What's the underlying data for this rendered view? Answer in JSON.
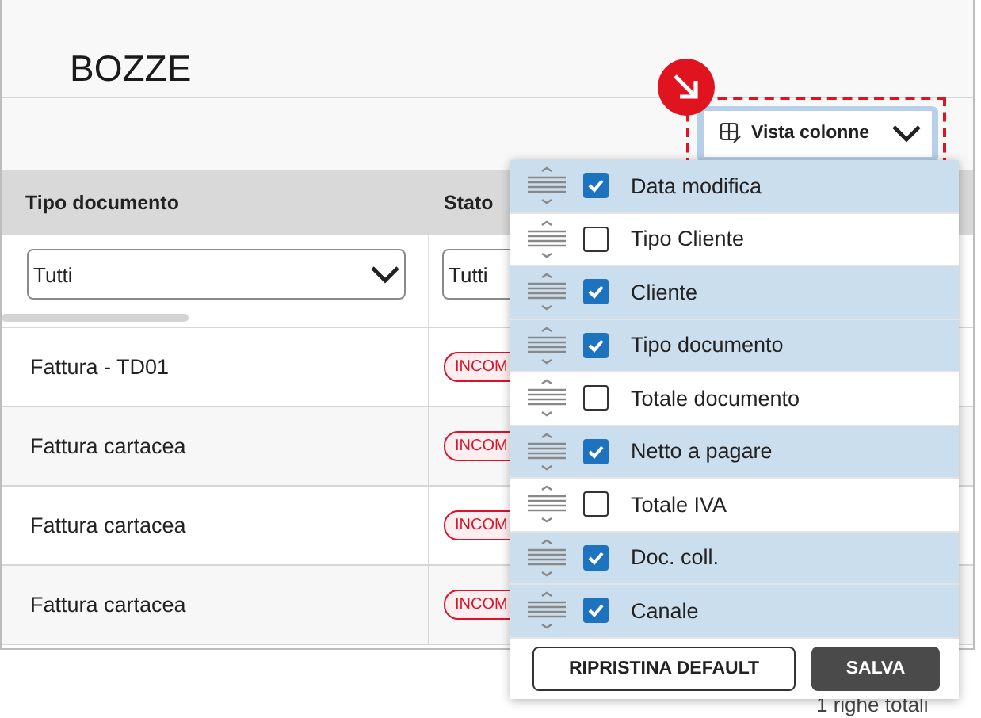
{
  "page": {
    "title": "BOZZE"
  },
  "toolbar": {
    "column_view_button": {
      "label": "Vista colonne",
      "expanded": true
    }
  },
  "table": {
    "columns": [
      {
        "label": "Tipo documento",
        "filter": "Tutti"
      },
      {
        "label": "Stato",
        "filter": "Tutti"
      }
    ],
    "rows": [
      {
        "type": "Fattura - TD01",
        "status": "INCOM"
      },
      {
        "type": "Fattura cartacea",
        "status": "INCOM"
      },
      {
        "type": "Fattura cartacea",
        "status": "INCOM"
      },
      {
        "type": "Fattura cartacea",
        "status": "INCOM"
      }
    ]
  },
  "column_menu": {
    "items": [
      {
        "label": "Data modifica",
        "checked": true
      },
      {
        "label": "Tipo Cliente",
        "checked": false
      },
      {
        "label": "Cliente",
        "checked": true
      },
      {
        "label": "Tipo documento",
        "checked": true
      },
      {
        "label": "Totale documento",
        "checked": false
      },
      {
        "label": "Netto a pagare",
        "checked": true
      },
      {
        "label": "Totale IVA",
        "checked": false
      },
      {
        "label": "Doc. coll.",
        "checked": true
      },
      {
        "label": "Canale",
        "checked": true
      }
    ],
    "buttons": [
      {
        "label": "RIPRISTINA DEFAULT",
        "kind": "secondary"
      },
      {
        "label": "SALVA",
        "kind": "primary"
      }
    ]
  },
  "footer": {
    "total": "1 righe totali"
  }
}
